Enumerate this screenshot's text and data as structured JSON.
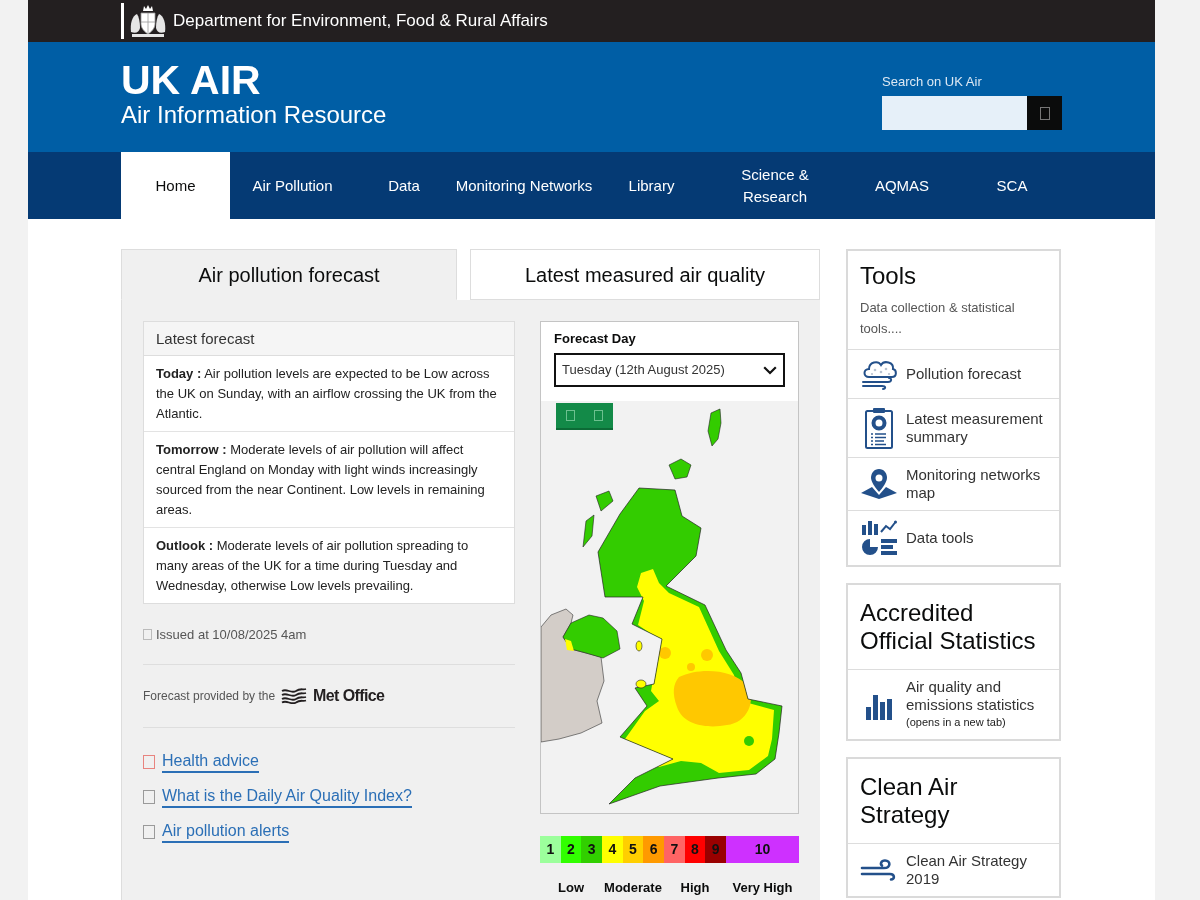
{
  "agency": {
    "name": "Department for Environment, Food & Rural Affairs"
  },
  "header": {
    "title": "UK AIR",
    "subtitle": "Air Information Resource",
    "search": {
      "label": "Search on UK Air"
    }
  },
  "nav": [
    {
      "label": "Home",
      "selected": true
    },
    {
      "label": "Air Pollution",
      "selected": false
    },
    {
      "label": "Data",
      "selected": false
    },
    {
      "label": "Monitoring Networks",
      "selected": false
    },
    {
      "label": "Library",
      "selected": false
    },
    {
      "label": "Science & Research",
      "selected": false
    },
    {
      "label": "AQMAS",
      "selected": false
    },
    {
      "label": "SCA",
      "selected": false
    }
  ],
  "tabs": [
    {
      "label": "Air pollution forecast",
      "selected": true
    },
    {
      "label": "Latest measured air quality",
      "selected": false
    }
  ],
  "forecast": {
    "heading": "Latest forecast",
    "items": [
      "**Today :** Air pollution levels are expected to be Low across the UK on Sunday, with an airflow crossing the UK from the Atlantic.",
      "**Tomorrow :** Moderate levels of air pollution will affect central England on Monday with light winds increasingly sourced from the near Continent. Low levels in remaining areas.",
      "**Outlook :** Moderate levels of air pollution spreading to many areas of the UK for a time during Tuesday and Wednesday, otherwise Low levels prevailing."
    ],
    "issued": "Issued at 10/08/2025 4am",
    "provider": {
      "text": "Forecast provided by the",
      "logo_text": "Met Office"
    }
  },
  "links": [
    {
      "label": "Health advice",
      "color": "#e8847f"
    },
    {
      "label": "What is the Daily Air Quality Index?",
      "color": "#9a9a9a"
    },
    {
      "label": "Air pollution alerts",
      "color": "#9a9a9a"
    }
  ],
  "map": {
    "day_label": "Forecast Day",
    "day_value": "Tuesday (12th August 2025)"
  },
  "legend": [
    {
      "label": "Low",
      "levels": [
        {
          "label": "1",
          "color": "#9cff9c"
        },
        {
          "label": "2",
          "color": "#31ff00"
        },
        {
          "label": "3",
          "color": "#31cf00"
        }
      ]
    },
    {
      "label": "Moderate",
      "levels": [
        {
          "label": "4",
          "color": "#ffff00"
        },
        {
          "label": "5",
          "color": "#ffcf00"
        },
        {
          "label": "6",
          "color": "#ff9a00"
        }
      ]
    },
    {
      "label": "High",
      "levels": [
        {
          "label": "7",
          "color": "#ff6464"
        },
        {
          "label": "8",
          "color": "#ff0000"
        },
        {
          "label": "9",
          "color": "#990000"
        }
      ]
    },
    {
      "label": "Very High",
      "levels": [
        {
          "label": "10",
          "color": "#ce30ff"
        }
      ]
    }
  ],
  "sidebar": [
    {
      "title": "Tools",
      "description": "Data collection & statistical tools....",
      "items": [
        {
          "kind": "forecast",
          "label": "Pollution forecast"
        },
        {
          "kind": "summary",
          "label": "Latest measurement summary"
        },
        {
          "kind": "map",
          "label": "Monitoring networks map"
        },
        {
          "kind": "data",
          "label": "Data tools"
        }
      ]
    },
    {
      "title": "Accredited Official Statistics",
      "items": [
        {
          "kind": "statistics",
          "label": "Air quality and emissions statistics",
          "note": "(opens in a new tab)"
        }
      ]
    },
    {
      "title": "Clean Air Strategy",
      "items": [
        {
          "kind": "strategy",
          "label": "Clean Air Strategy 2019"
        }
      ]
    }
  ]
}
